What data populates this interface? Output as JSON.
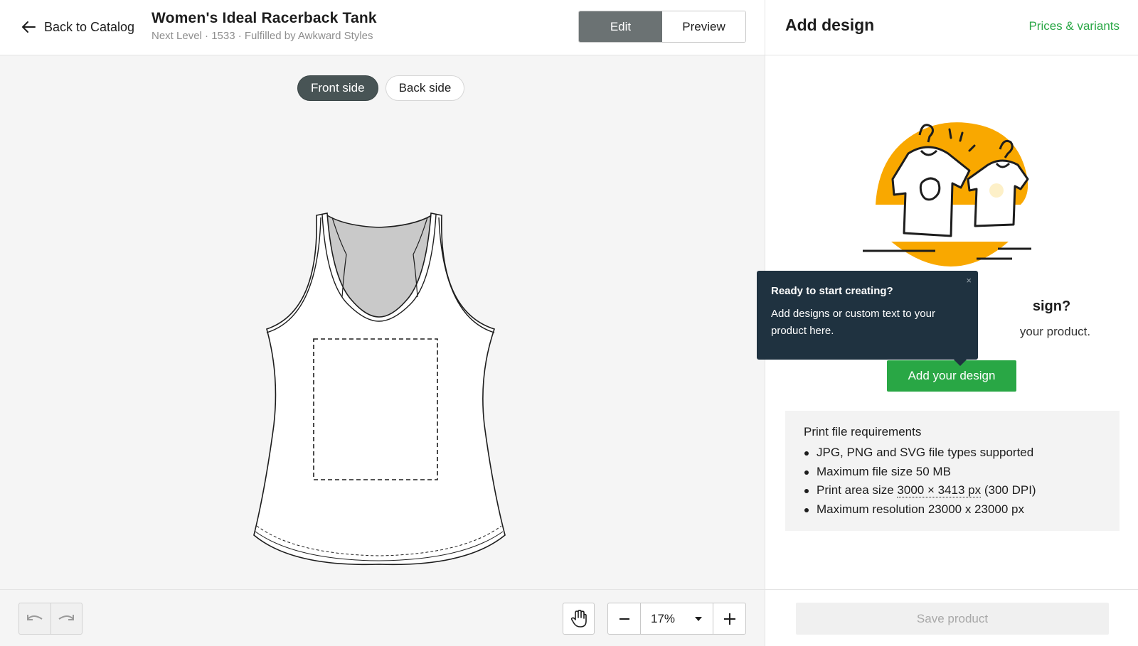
{
  "header": {
    "back_label": "Back to Catalog",
    "product_title": "Women's Ideal Racerback Tank",
    "product_subtitle": "Next Level · 1533 · Fulfilled by Awkward Styles",
    "mode_edit": "Edit",
    "mode_preview": "Preview",
    "active_mode": "Edit"
  },
  "canvas": {
    "front_side_label": "Front side",
    "back_side_label": "Back side",
    "active_side": "Front side"
  },
  "toolbar": {
    "undo_icon": "undo-icon",
    "redo_icon": "redo-icon",
    "hand_icon": "hand-pan-icon",
    "zoom_value": "17%",
    "zoom_out_label": "−",
    "zoom_in_label": "+"
  },
  "panel": {
    "title": "Add design",
    "prices_link": "Prices & variants",
    "question": "sign?",
    "question_sub": "your product.",
    "add_button": "Add your design",
    "requirements": {
      "title": "Print file requirements",
      "items": [
        "JPG, PNG and SVG file types supported",
        "Maximum file size 50 MB",
        "Print area size",
        "Maximum resolution 23000 x 23000 px"
      ],
      "print_area_value": "3000 × 3413 px",
      "print_area_dpi": "(300 DPI)"
    },
    "save_button": "Save product"
  },
  "tooltip": {
    "title": "Ready to start creating?",
    "body": "Add designs or custom text to your product here.",
    "close": "×"
  },
  "colors": {
    "accent_green": "#29a745",
    "illustration_orange": "#f9a800",
    "tooltip_bg": "#1f3240",
    "active_toggle": "#6b7273"
  }
}
